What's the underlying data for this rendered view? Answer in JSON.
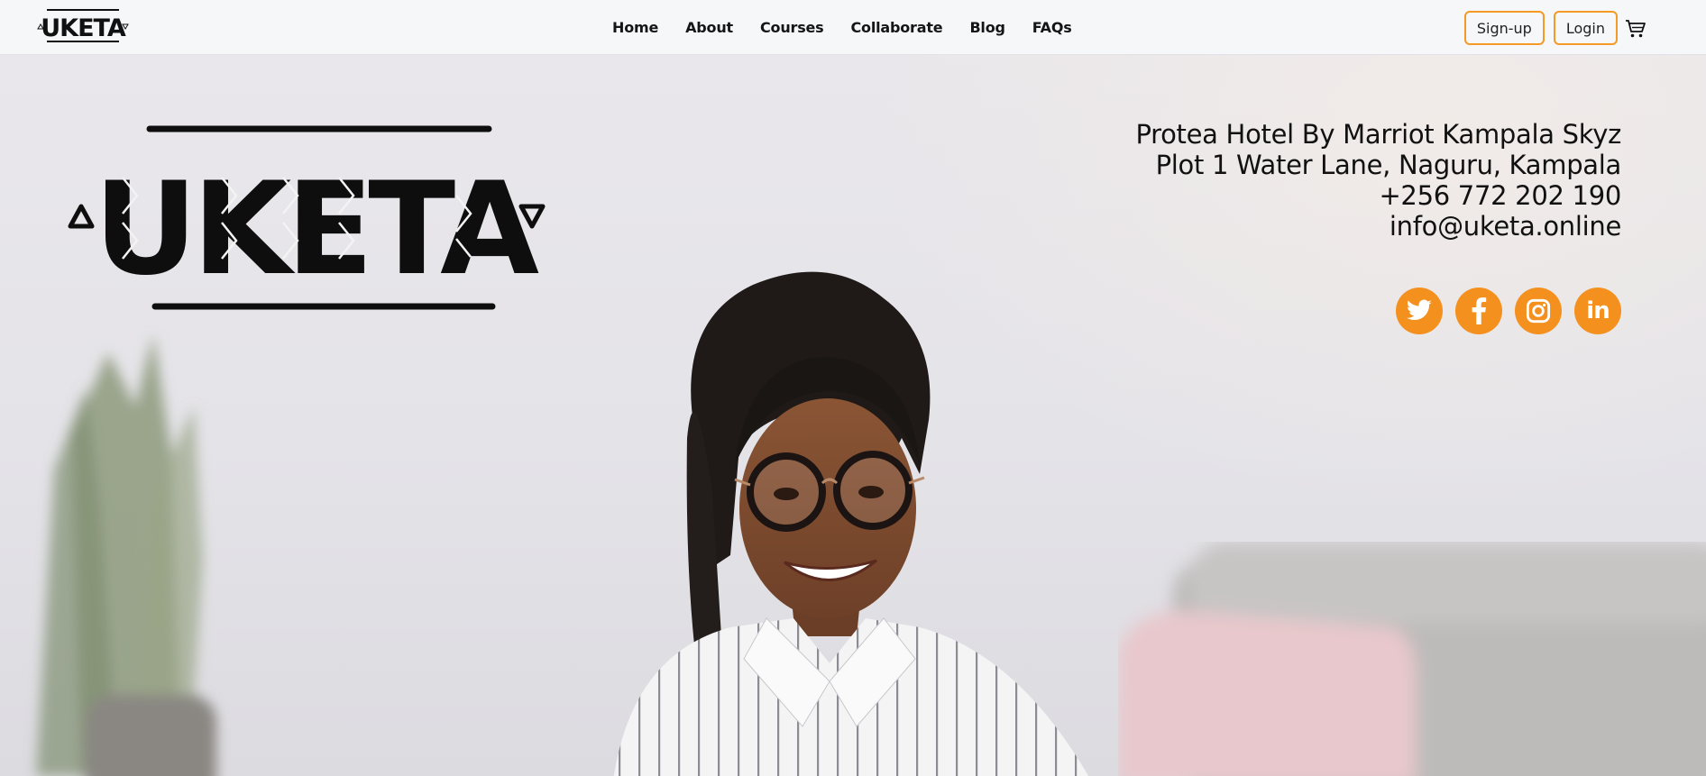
{
  "brand": {
    "name": "UKETA"
  },
  "nav": {
    "items": [
      {
        "label": "Home"
      },
      {
        "label": "About"
      },
      {
        "label": "Courses"
      },
      {
        "label": "Collaborate"
      },
      {
        "label": "Blog"
      },
      {
        "label": "FAQs"
      }
    ]
  },
  "auth": {
    "signup_label": "Sign-up",
    "login_label": "Login"
  },
  "cart": {
    "icon": "cart-icon"
  },
  "hero": {
    "logo_text": "UKETA",
    "contact": {
      "venue": "Protea Hotel By Marriot Kampala Skyz",
      "address": "Plot 1 Water Lane, Naguru, Kampala",
      "phone": "+256 772 202 190",
      "email": "info@uketa.online"
    },
    "socials": [
      {
        "icon": "twitter-icon"
      },
      {
        "icon": "facebook-icon"
      },
      {
        "icon": "instagram-icon"
      },
      {
        "icon": "linkedin-icon",
        "glyph": "in"
      }
    ]
  },
  "colors": {
    "accent": "#f4901e",
    "nav_bg": "#f6f7f9",
    "text": "#111111"
  }
}
